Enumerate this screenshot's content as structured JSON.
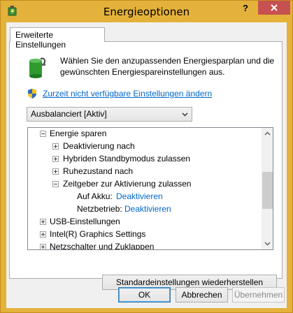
{
  "window": {
    "title": "Energieoptionen",
    "help_label": "?",
    "close_label": "X",
    "app_icon": "power-options-icon"
  },
  "tabs": [
    {
      "label": "Erweiterte Einstellungen",
      "selected": true
    }
  ],
  "header": {
    "description": "Wählen Sie den anzupassenden Energiesparplan und die gewünschten Energiespareinstellungen aus.",
    "change_link": "Zurzeit nicht verfügbare Einstellungen ändern",
    "icons": [
      "battery-plan-icon",
      "uac-shield-icon"
    ]
  },
  "plan": {
    "selected": "Ausbalanciert [Aktiv]"
  },
  "tree": {
    "nodes": [
      {
        "label": "Energie sparen",
        "state": "expanded",
        "level": 0
      },
      {
        "label": "Deaktivierung nach",
        "state": "collapsed",
        "level": 1
      },
      {
        "label": "Hybriden Standbymodus zulassen",
        "state": "collapsed",
        "level": 1
      },
      {
        "label": "Ruhezustand nach",
        "state": "collapsed",
        "level": 1
      },
      {
        "label": "Zeitgeber zur Aktivierung zulassen",
        "state": "expanded",
        "level": 1
      },
      {
        "label": "Auf Akku:",
        "value": "Deaktivieren",
        "level": 2
      },
      {
        "label": "Netzbetrieb:",
        "value": "Deaktivieren",
        "level": 2
      },
      {
        "label": "USB-Einstellungen",
        "state": "collapsed",
        "level": 0
      },
      {
        "label": "Intel(R) Graphics Settings",
        "state": "collapsed",
        "level": 0
      },
      {
        "label": "Netzschalter und Zuklappen",
        "state": "collapsed",
        "level": 0
      }
    ],
    "scroll_fraction": 0.4
  },
  "buttons": {
    "restore": "Standardeinstellungen wiederherstellen",
    "ok": "OK",
    "cancel": "Abbrechen",
    "apply": "Übernehmen"
  },
  "colors": {
    "titlebar": "#e4b23a",
    "close": "#c75050",
    "link": "#0066cc"
  }
}
